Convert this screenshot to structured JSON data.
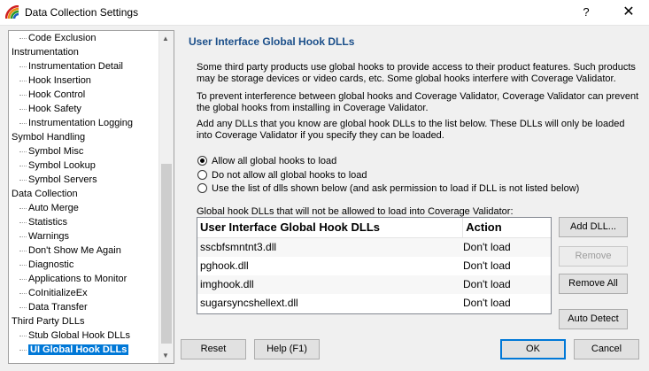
{
  "window": {
    "title": "Data Collection Settings",
    "help_glyph": "?",
    "close_glyph": "✕"
  },
  "tree": {
    "items": [
      {
        "label": "Code Exclusion",
        "level": 1
      },
      {
        "label": "Instrumentation",
        "level": 0
      },
      {
        "label": "Instrumentation Detail",
        "level": 1
      },
      {
        "label": "Hook Insertion",
        "level": 1
      },
      {
        "label": "Hook Control",
        "level": 1
      },
      {
        "label": "Hook Safety",
        "level": 1
      },
      {
        "label": "Instrumentation Logging",
        "level": 1
      },
      {
        "label": "Symbol Handling",
        "level": 0
      },
      {
        "label": "Symbol Misc",
        "level": 1
      },
      {
        "label": "Symbol Lookup",
        "level": 1
      },
      {
        "label": "Symbol Servers",
        "level": 1
      },
      {
        "label": "Data Collection",
        "level": 0
      },
      {
        "label": "Auto Merge",
        "level": 1
      },
      {
        "label": "Statistics",
        "level": 1
      },
      {
        "label": "Warnings",
        "level": 1
      },
      {
        "label": "Don't Show Me Again",
        "level": 1
      },
      {
        "label": "Diagnostic",
        "level": 1
      },
      {
        "label": "Applications to Monitor",
        "level": 1
      },
      {
        "label": "CoInitializeEx",
        "level": 1
      },
      {
        "label": "Data Transfer",
        "level": 1
      },
      {
        "label": "Third Party DLLs",
        "level": 0
      },
      {
        "label": "Stub Global Hook DLLs",
        "level": 1
      },
      {
        "label": "UI Global Hook DLLs",
        "level": 1,
        "selected": true
      }
    ]
  },
  "panel": {
    "title": "User Interface Global Hook DLLs",
    "para1": "Some third party products use global hooks to provide access to their product features. Such products may be storage devices or video cards, etc. Some global hooks interfere with Coverage Validator.",
    "para2": "To prevent interference between global hooks and Coverage Validator, Coverage Validator can prevent the global hooks from installing in Coverage Validator.",
    "para3": "Add any DLLs that you know are global hook DLLs to the list below. These DLLs will only be loaded into Coverage Validator if you specify they can be loaded.",
    "radios": [
      {
        "label": "Allow all global hooks to load",
        "checked": true
      },
      {
        "label": "Do not allow all global hooks to load",
        "checked": false
      },
      {
        "label": "Use the list of dlls shown below (and ask permission to load if DLL is not listed below)",
        "checked": false
      }
    ],
    "list_label": "Global hook DLLs that will not be allowed to load into Coverage Validator:",
    "table": {
      "columns": [
        "User Interface Global Hook DLLs",
        "Action"
      ],
      "rows": [
        [
          "sscbfsmntnt3.dll",
          "Don't load"
        ],
        [
          "pghook.dll",
          "Don't load"
        ],
        [
          "imghook.dll",
          "Don't load"
        ],
        [
          "sugarsyncshellext.dll",
          "Don't load"
        ]
      ]
    },
    "buttons": {
      "add": "Add DLL...",
      "remove": "Remove",
      "remove_all": "Remove All",
      "auto_detect": "Auto Detect"
    }
  },
  "footer": {
    "reset": "Reset",
    "help": "Help (F1)",
    "ok": "OK",
    "cancel": "Cancel"
  },
  "colors": {
    "accent": "#0078d7",
    "section_title": "#1b4f8a"
  }
}
